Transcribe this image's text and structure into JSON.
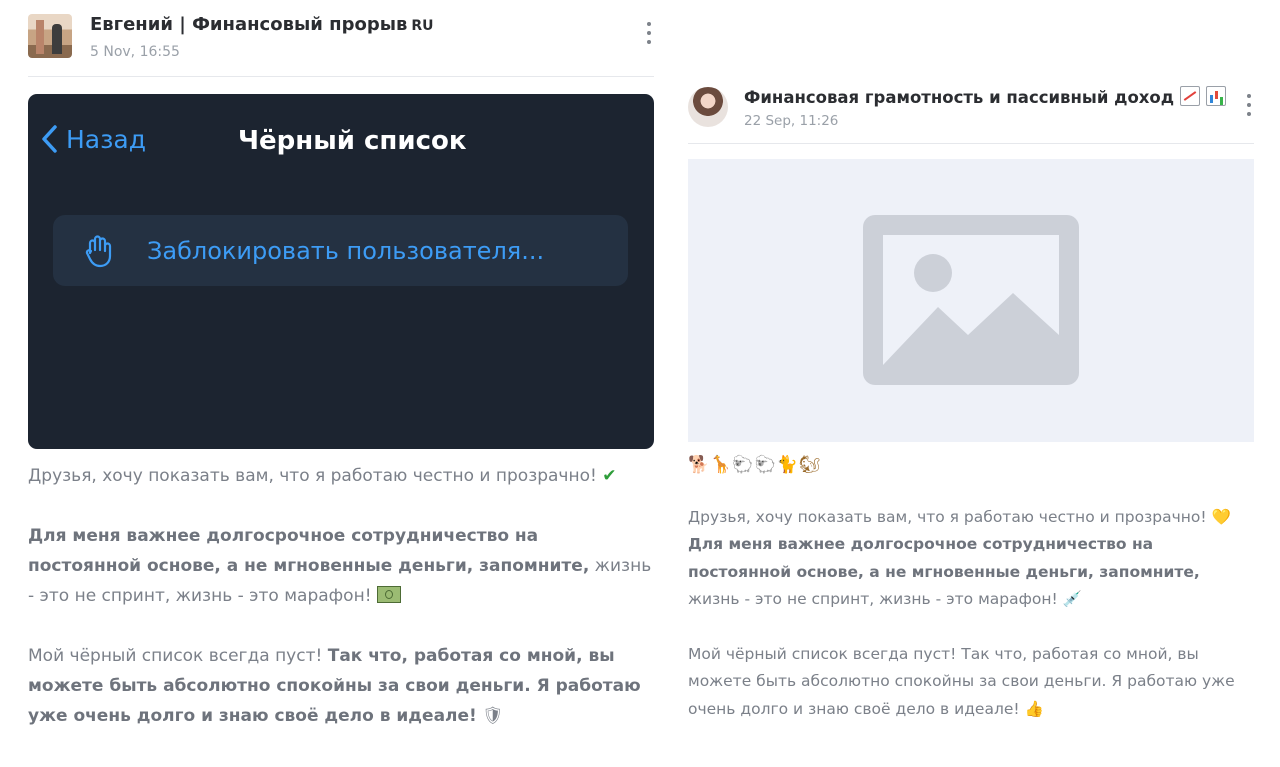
{
  "post_left": {
    "channel_name": "Евгений | Финансовый прорыв",
    "badge": "RU",
    "date": "5 Nov, 16:55",
    "media": {
      "back_label": "Назад",
      "title": "Чёрный список",
      "block_label": "Заблокировать пользователя..."
    },
    "paragraph1": "Друзья, хочу показать вам, что я работаю честно и прозрачно!",
    "paragraph1_emoji": "✔",
    "paragraph2_bold": "Для меня важнее долгосрочное сотрудничество на постоянной основе, а не мгновенные деньги, запомните,",
    "paragraph2_rest": " жизнь - это не спринт, жизнь - это марафон! ",
    "paragraph3_plain": "Мой чёрный список всегда пуст! ",
    "paragraph3_bold": "Так что, работая со мной, вы можете быть абсолютно спокойны за свои деньги. Я работаю уже очень долго и знаю своё дело в идеале!",
    "paragraph3_emoji": "🛡"
  },
  "post_right": {
    "channel_name": "Финансовая грамотность и пассивный доход",
    "date": "22 Sep, 11:26",
    "emoji_row": "🐕🦒🐑🐑🐈🐿",
    "paragraph1": "Друзья, хочу показать вам, что я работаю честно и прозрачно!",
    "paragraph1_emoji": "💛",
    "paragraph2_bold": "Для меня важнее долгосрочное сотрудничество на постоянной основе, а не мгновенные деньги, запомните,",
    "paragraph2_rest": " жизнь - это не спринт, жизнь - это марафон!",
    "paragraph2_emoji": "💉",
    "paragraph3": "Мой чёрный список всегда пуст! Так что, работая со мной, вы можете быть абсолютно спокойны за свои деньги. Я работаю уже очень долго и знаю своё дело в идеале!",
    "paragraph3_emoji": "👍"
  },
  "icons": {
    "menu": "more-vertical-icon",
    "back": "chevron-left-icon",
    "block": "hand-stop-icon",
    "placeholder": "image-placeholder-icon"
  },
  "colors": {
    "link_blue": "#3d9cf5",
    "dark_bg": "#1c2430",
    "row_bg": "#243142",
    "placeholder_bg": "#eef1f8"
  }
}
